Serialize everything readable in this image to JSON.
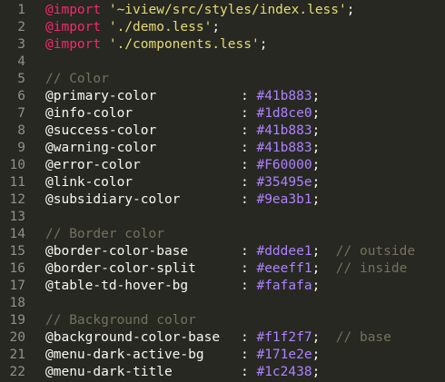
{
  "lines": [
    {
      "n": "1",
      "type": "import",
      "kw": "@import",
      "str": "'~iview/src/styles/index.less'",
      "end": ";"
    },
    {
      "n": "2",
      "type": "import",
      "kw": "@import",
      "str": "'./demo.less'",
      "end": ";"
    },
    {
      "n": "3",
      "type": "import",
      "kw": "@import",
      "str": "'./components.less'",
      "end": ";"
    },
    {
      "n": "4",
      "type": "blank"
    },
    {
      "n": "5",
      "type": "comment",
      "text": "// Color"
    },
    {
      "n": "6",
      "type": "decl",
      "var": "@primary-color",
      "colon": ":",
      "val": "#41b883",
      "end": ";"
    },
    {
      "n": "7",
      "type": "decl",
      "var": "@info-color",
      "colon": ":",
      "val": "#1d8ce0",
      "end": ";"
    },
    {
      "n": "8",
      "type": "decl",
      "var": "@success-color",
      "colon": ":",
      "val": "#41b883",
      "end": ";"
    },
    {
      "n": "9",
      "type": "decl",
      "var": "@warning-color",
      "colon": ":",
      "val": "#41b883",
      "end": ";"
    },
    {
      "n": "10",
      "type": "decl",
      "var": "@error-color",
      "colon": ":",
      "val": "#F60000",
      "end": ";"
    },
    {
      "n": "11",
      "type": "decl",
      "var": "@link-color",
      "colon": ":",
      "val": "#35495e",
      "end": ";"
    },
    {
      "n": "12",
      "type": "decl",
      "var": "@subsidiary-color",
      "colon": ":",
      "val": "#9ea3b1",
      "end": ";"
    },
    {
      "n": "13",
      "type": "blank"
    },
    {
      "n": "14",
      "type": "comment",
      "text": "// Border color"
    },
    {
      "n": "15",
      "type": "decl",
      "var": "@border-color-base",
      "colon": ":",
      "val": "#dddee1",
      "end": ";",
      "comment": "// outside"
    },
    {
      "n": "16",
      "type": "decl",
      "var": "@border-color-split",
      "colon": ":",
      "val": "#eeeff1",
      "end": ";",
      "comment": "// inside"
    },
    {
      "n": "17",
      "type": "decl",
      "var": "@table-td-hover-bg",
      "colon": ":",
      "val": "#fafafa",
      "end": ";"
    },
    {
      "n": "18",
      "type": "blank"
    },
    {
      "n": "19",
      "type": "comment",
      "text": "// Background color"
    },
    {
      "n": "20",
      "type": "decl",
      "var": "@background-color-base",
      "colon": ":",
      "val": "#f1f2f7",
      "end": ";",
      "comment": "// base"
    },
    {
      "n": "21",
      "type": "decl",
      "var": "@menu-dark-active-bg",
      "colon": ":",
      "val": "#171e2e",
      "end": ";"
    },
    {
      "n": "22",
      "type": "decl",
      "var": "@menu-dark-title",
      "colon": ":",
      "val": "#1c2438",
      "end": ";"
    }
  ],
  "colors": {
    "background": "#272822",
    "gutter": "#90908a",
    "keyword": "#f92672",
    "string": "#e6db74",
    "comment": "#75715e",
    "value": "#ae81ff",
    "text": "#f8f8f2"
  }
}
